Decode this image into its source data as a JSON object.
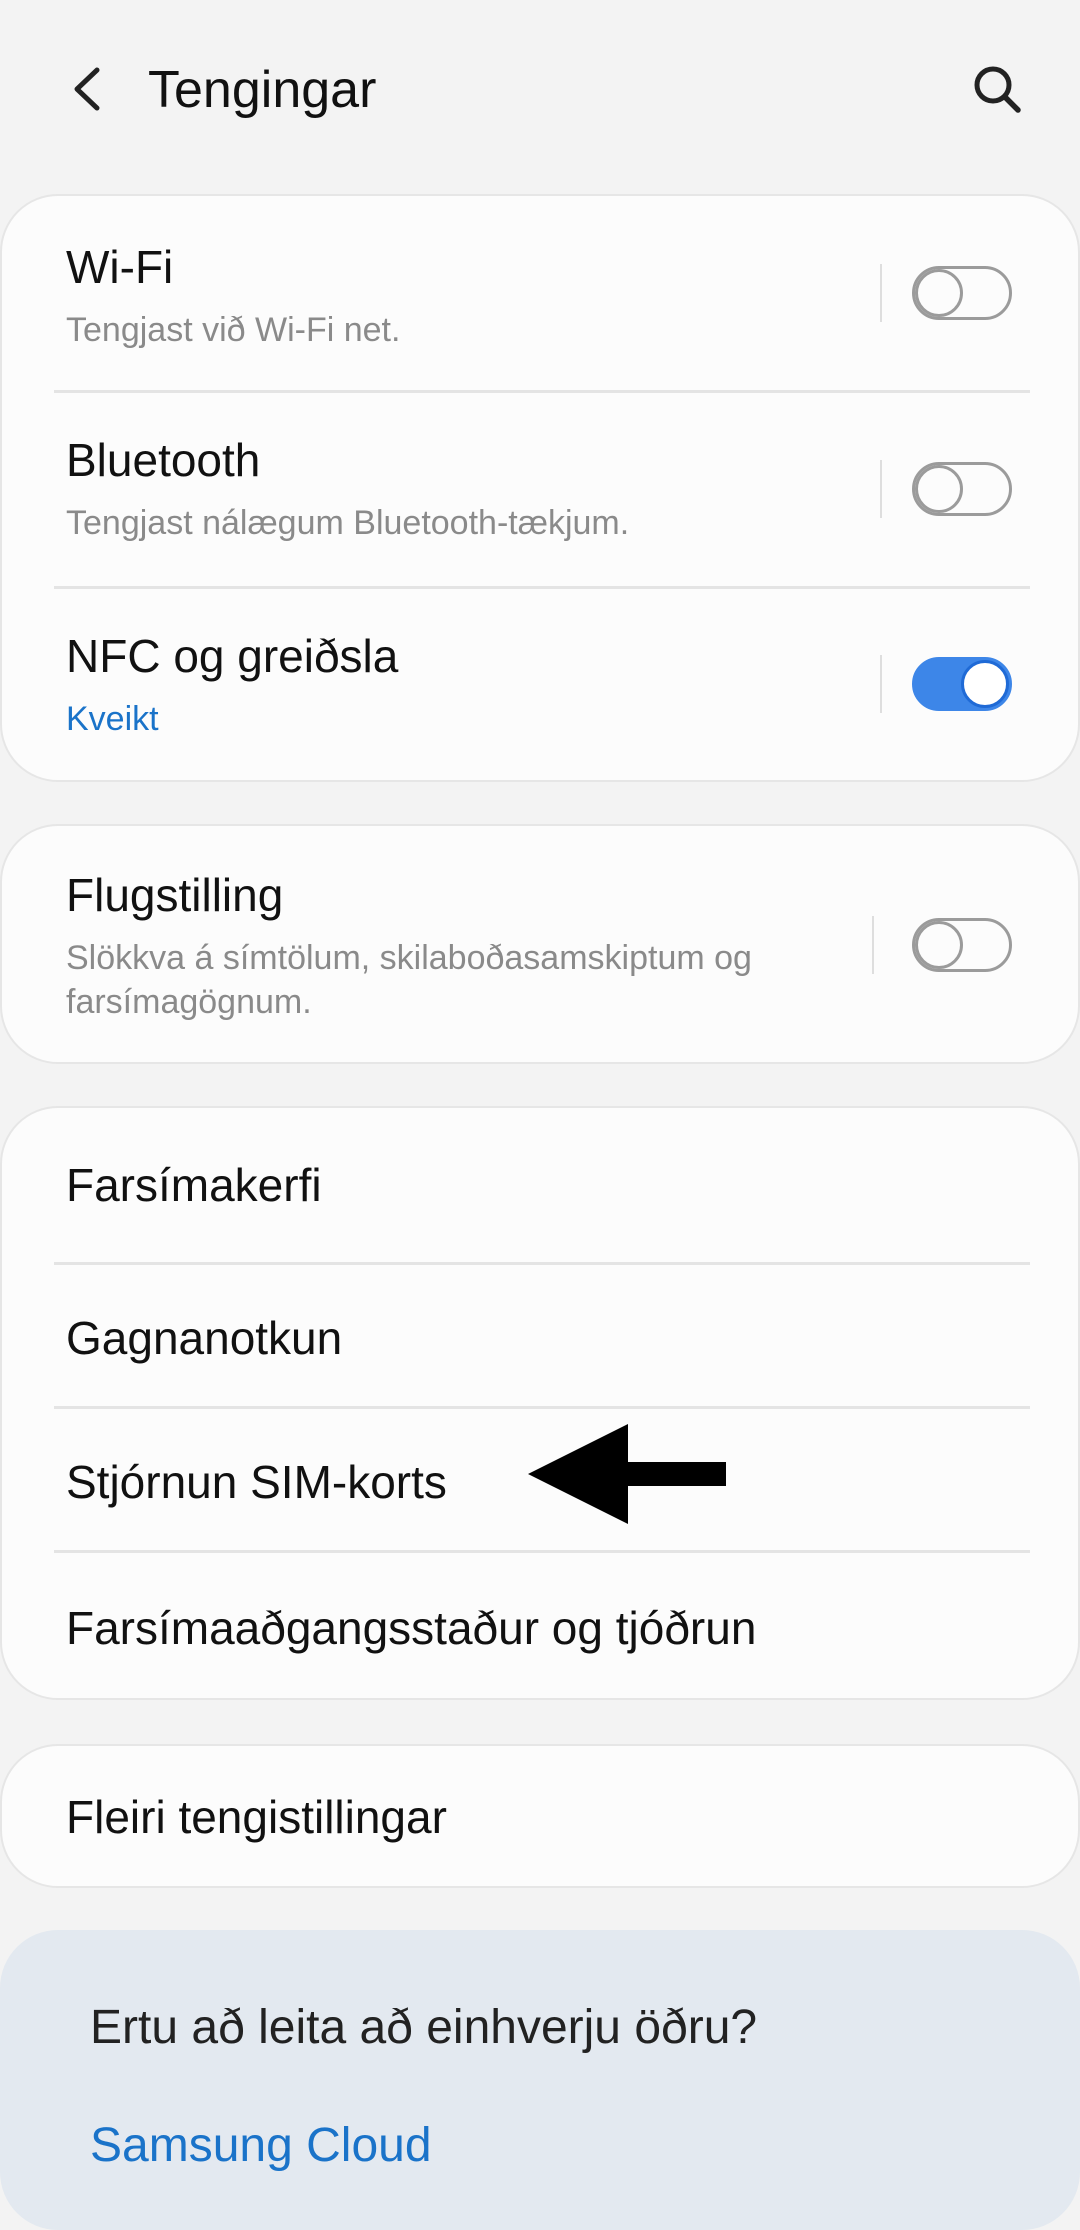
{
  "header": {
    "title": "Tengingar",
    "back_icon": "chevron-left-icon",
    "search_icon": "search-icon"
  },
  "card1": {
    "wifi": {
      "title": "Wi-Fi",
      "subtitle": "Tengjast við Wi-Fi net.",
      "toggle_on": false
    },
    "bluetooth": {
      "title": "Bluetooth",
      "subtitle": "Tengjast nálægum Bluetooth-tækjum.",
      "toggle_on": false
    },
    "nfc": {
      "title": "NFC og greiðsla",
      "subtitle": "Kveikt",
      "toggle_on": true
    }
  },
  "card2": {
    "airplane": {
      "title": "Flugstilling",
      "subtitle": "Slökkva á símtölum, skilaboðasamskiptum og farsímagögnum.",
      "toggle_on": false
    }
  },
  "card3": {
    "items": [
      {
        "title": "Farsímakerfi"
      },
      {
        "title": "Gagnanotkun"
      },
      {
        "title": "Stjórnun SIM-korts"
      },
      {
        "title": "Farsímaaðgangsstaður og tjóðrun"
      }
    ]
  },
  "card4": {
    "more": {
      "title": "Fleiri tengistillingar"
    }
  },
  "suggestions": {
    "title": "Ertu að leita að einhverju öðru?",
    "link": "Samsung Cloud"
  },
  "colors": {
    "accent": "#1a73c9",
    "toggle_on": "#3d86e8",
    "background": "#f3f3f3",
    "card": "#fcfcfc",
    "suggest_bg": "#e3e9f0"
  },
  "annotation": {
    "arrow_icon": "arrow-left-icon"
  }
}
